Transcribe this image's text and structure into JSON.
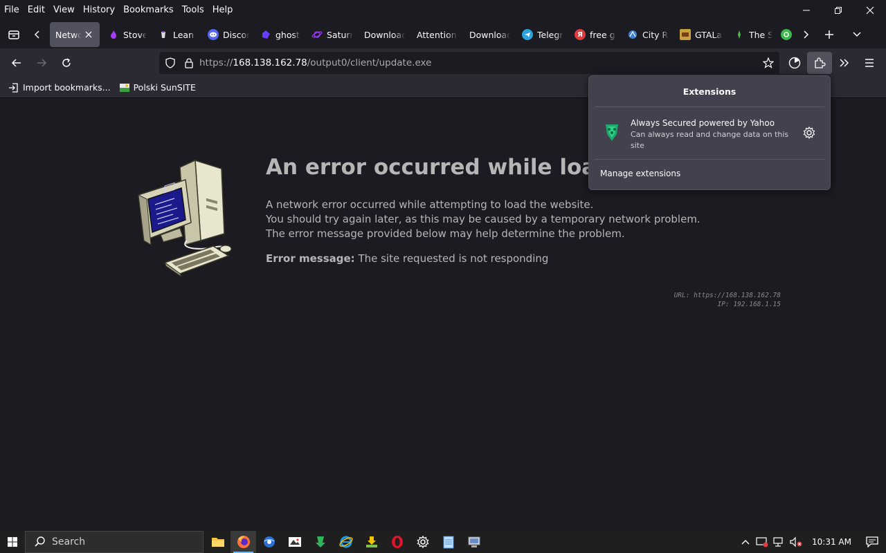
{
  "menubar": {
    "items": [
      "File",
      "Edit",
      "View",
      "History",
      "Bookmarks",
      "Tools",
      "Help"
    ]
  },
  "tabs": [
    {
      "label": "Networ",
      "active": true
    },
    {
      "label": "Stove",
      "fav_color": "#a33cff"
    },
    {
      "label": "Lean S",
      "fav_color": "#dcdcdc"
    },
    {
      "label": "Discor",
      "fav_color": "#5865f2"
    },
    {
      "label": "ghost",
      "fav_color": "#6a3cff"
    },
    {
      "label": "Saturn",
      "fav_color": "#9b36ff"
    },
    {
      "label": "Download",
      "fav_color": ""
    },
    {
      "label": "Attention",
      "fav_color": ""
    },
    {
      "label": "Download",
      "fav_color": ""
    },
    {
      "label": "Telegr",
      "fav_color": "#2aa3df"
    },
    {
      "label": "free g",
      "fav_color": "#e23c3c"
    },
    {
      "label": "City R",
      "fav_color": "#3c7fd6"
    },
    {
      "label": "GTALa",
      "fav_color": "#c8a040"
    },
    {
      "label": "The Si",
      "fav_color": "#4cc24c"
    }
  ],
  "urlbar": {
    "scheme": "https://",
    "host": "168.138.162.78",
    "path": "/output0/client/update.exe"
  },
  "bookmarks": [
    {
      "label": "Import bookmarks..."
    },
    {
      "label": "Polski SunSITE"
    }
  ],
  "error": {
    "title": "An error occurred while loading",
    "lines": [
      "A network error occurred while attempting to load the website.",
      "You should try again later, as this may be caused by a temporary network problem.",
      "The error message provided below may help determine the problem."
    ],
    "message_label": "Error message:",
    "message": "The site requested is not responding",
    "url_line": "URL: https://168.138.162.78",
    "ip_line": "IP: 192.168.1.15"
  },
  "extensions_panel": {
    "title": "Extensions",
    "item_name": "Always Secured powered by Yahoo",
    "item_permission": "Can always read and change data on this site",
    "manage": "Manage extensions"
  },
  "taskbar": {
    "search_placeholder": "Search",
    "time": "10:31 AM"
  },
  "colors": {
    "accent": "#76b9ed",
    "panel": "#42414d",
    "content_bg": "#1c1b22"
  }
}
